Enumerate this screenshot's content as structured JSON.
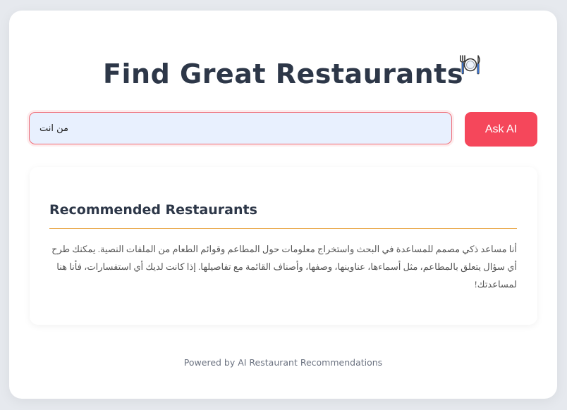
{
  "header": {
    "title": "Find Great Restaurants",
    "icon": "plate-cutlery-icon"
  },
  "search": {
    "value": "من انت",
    "button_label": "Ask AI"
  },
  "results": {
    "heading": "Recommended Restaurants",
    "text": "أنا مساعد ذكي مصمم للمساعدة في البحث واستخراج معلومات حول المطاعم وقوائم الطعام من الملفات النصية. يمكنك طرح أي سؤال يتعلق بالمطاعم، مثل أسماءها، عناوينها، وصفها، وأصناف القائمة مع تفاصيلها. إذا كانت لديك أي استفسارات، فأنا هنا لمساعدتك!"
  },
  "footer": {
    "text": "Powered by AI Restaurant Recommendations"
  },
  "colors": {
    "accent": "#f5475b",
    "heading": "#2d3748",
    "divider": "#e8a23c",
    "input_bg": "#e8f0fe"
  }
}
